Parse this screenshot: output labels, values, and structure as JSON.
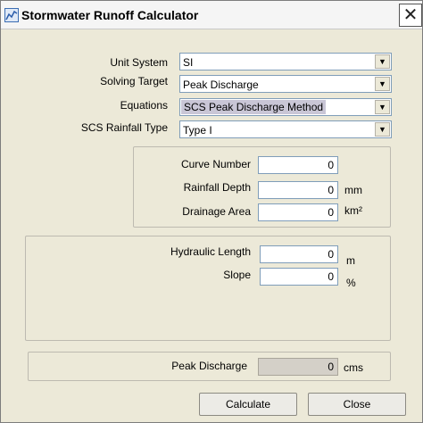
{
  "window": {
    "title": "Stormwater Runoff Calculator"
  },
  "form": {
    "unit_system": {
      "label": "Unit System",
      "value": "SI"
    },
    "solving_target": {
      "label": "Solving Target",
      "value": "Peak Discharge"
    },
    "equations": {
      "label": "Equations",
      "value": "SCS Peak Discharge Method"
    },
    "rainfall_type": {
      "label": "SCS Rainfall Type",
      "value": "Type I"
    }
  },
  "inputs": {
    "curve_number": {
      "label": "Curve Number",
      "value": "0",
      "unit": ""
    },
    "rainfall_depth": {
      "label": "Rainfall Depth",
      "value": "0",
      "unit": "mm"
    },
    "drainage_area": {
      "label": "Drainage Area",
      "value": "0",
      "unit": "km²"
    },
    "hydraulic_length": {
      "label": "Hydraulic Length",
      "value": "0",
      "unit": "m"
    },
    "slope": {
      "label": "Slope",
      "value": "0",
      "unit": "%"
    }
  },
  "result": {
    "peak_discharge": {
      "label": "Peak Discharge",
      "value": "0",
      "unit": "cms"
    }
  },
  "buttons": {
    "calculate": "Calculate",
    "close": "Close"
  },
  "icons": {
    "dropdown": "▼",
    "close": "✕"
  }
}
